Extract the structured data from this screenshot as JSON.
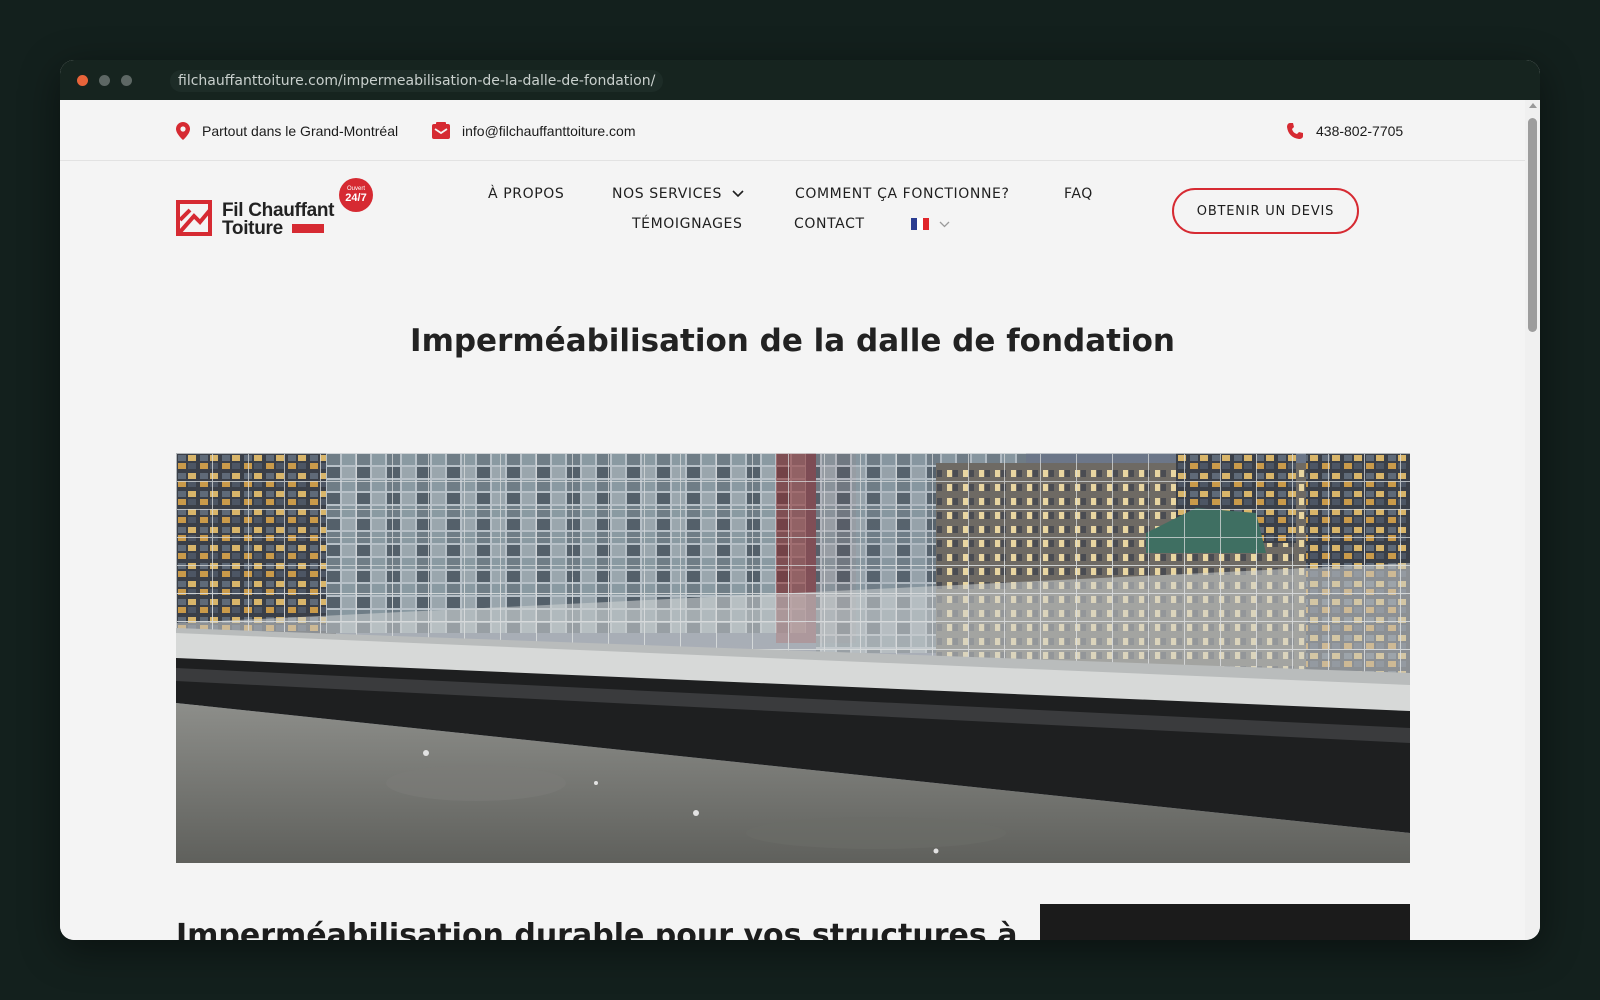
{
  "browser": {
    "url": "filchauffanttoiture.com/impermeabilisation-de-la-dalle-de-fondation/"
  },
  "topbar": {
    "location": "Partout dans le Grand-Montréal",
    "email": "info@filchauffanttoiture.com",
    "phone": "438-802-7705"
  },
  "logo": {
    "line1": "Fil Chauffant",
    "line2": "Toiture",
    "badge_top": "Ouvert",
    "badge_main": "24/7"
  },
  "nav": {
    "about": "À PROPOS",
    "services": "NOS SERVICES",
    "how": "COMMENT ÇA FONCTIONNE?",
    "faq": "FAQ",
    "testimonials": "TÉMOIGNAGES",
    "contact": "CONTACT"
  },
  "cta": {
    "label": "OBTENIR UN DEVIS"
  },
  "page": {
    "title": "Imperméabilisation de la dalle de fondation",
    "section_title": "Imperméabilisation durable pour vos structures à"
  },
  "colors": {
    "accent": "#d62a32",
    "background": "#f4f4f4",
    "text": "#1f1f1f"
  }
}
